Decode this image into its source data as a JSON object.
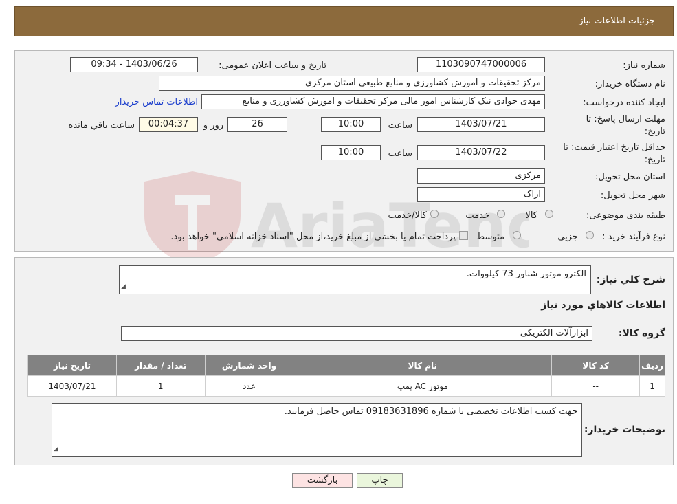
{
  "header": {
    "title": "جزئیات اطلاعات نیاز"
  },
  "form": {
    "need_number": {
      "label": "شماره نیاز:",
      "value": "1103090747000006"
    },
    "announce": {
      "label": "تاریخ و ساعت اعلان عمومی:",
      "value": "1403/06/26 - 09:34"
    },
    "buyer": {
      "label": "نام دستگاه خریدار:",
      "value": "مرکز تحقیقات و اموزش کشاورزی و منابع طبیعی استان مرکزی"
    },
    "creator": {
      "label": "ایجاد کننده درخواست:",
      "value": "مهدی جوادی نیک کارشناس امور مالی مرکز تحقیقات و اموزش کشاورزی و منابع",
      "contact_link": "اطلاعات تماس خریدار"
    },
    "deadline": {
      "label_line1": "مهلت ارسال پاسخ: تا",
      "label_line2": "تاریخ:",
      "date": "1403/07/21",
      "time_label": "ساعت",
      "time": "10:00",
      "days": "26",
      "days_label": "روز و",
      "remaining": "00:04:37",
      "remaining_label": "ساعت باقي مانده"
    },
    "validity": {
      "label_line1": "حداقل تاریخ اعتبار قیمت: تا",
      "label_line2": "تاریخ:",
      "date": "1403/07/22",
      "time_label": "ساعت",
      "time": "10:00"
    },
    "province": {
      "label": "استان محل تحویل:",
      "value": "مرکزی"
    },
    "city": {
      "label": "شهر محل تحویل:",
      "value": "اراک"
    },
    "category": {
      "label": "طبقه بندی موضوعی:",
      "options": [
        "کالا",
        "خدمت",
        "کالا/خدمت"
      ]
    },
    "process": {
      "label": "نوع فرآیند خرید :",
      "options": [
        "جزيي",
        "متوسط"
      ],
      "note": "پرداخت تمام یا بخشی از مبلغ خرید،از محل \"اسناد خزانه اسلامی\" خواهد بود."
    }
  },
  "desc": {
    "label": "شرح کلي نياز:",
    "value": "الکترو موتور شناور 73 کیلووات."
  },
  "goods": {
    "heading": "اطلاعات کالاهاي مورد نياز",
    "group_label": "گروه کالا:",
    "group_value": "ابزارآلات الکتریکی",
    "columns": [
      "رديف",
      "کد کالا",
      "نام کالا",
      "واحد شمارش",
      "تعداد / مقدار",
      "تاریخ نیاز"
    ],
    "rows": [
      {
        "row": "1",
        "code": "--",
        "name": "موتور AC پمپ",
        "unit": "عدد",
        "qty": "1",
        "date": "1403/07/21"
      }
    ]
  },
  "buyer_notes": {
    "label": "توضیحات خریدار:",
    "value": "جهت کسب اطلاعات تخصصی با شماره 09183631896 تماس حاصل فرمایید."
  },
  "buttons": {
    "print": "چاپ",
    "back": "بازگشت"
  },
  "watermark": {
    "text": "AriaTender.neT"
  }
}
